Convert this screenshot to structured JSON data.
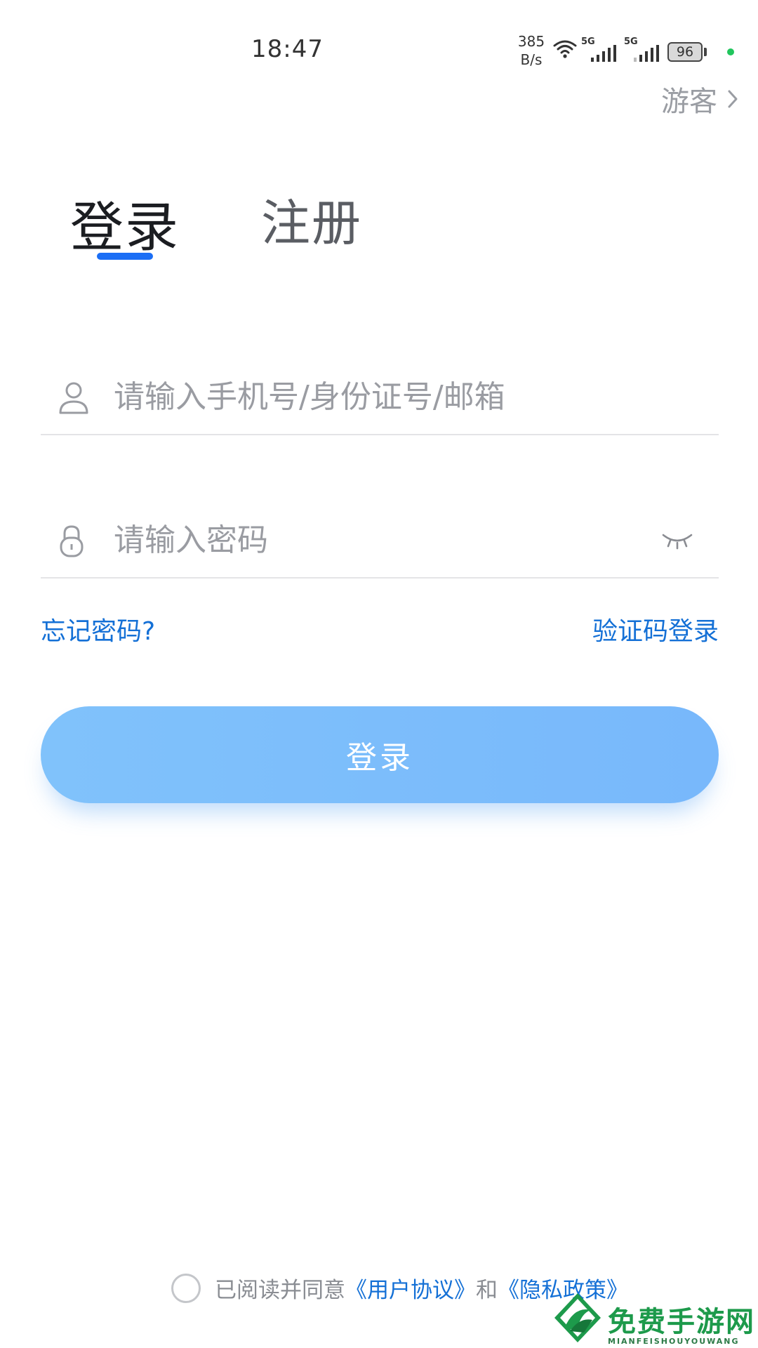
{
  "status_bar": {
    "time": "18:47",
    "net_speed_value": "385",
    "net_speed_unit": "B/s",
    "signal1_label": "5G",
    "signal2_label": "5G",
    "battery": "96",
    "wifi_icon": "wifi-icon",
    "signal_icon": "cellular-signal-icon"
  },
  "guest": {
    "label": "游客",
    "icon": "chevron-right-icon"
  },
  "tabs": [
    {
      "label": "登录",
      "active": true
    },
    {
      "label": "注册",
      "active": false
    }
  ],
  "form": {
    "account": {
      "placeholder": "请输入手机号/身份证号/邮箱",
      "value": "",
      "icon": "user-icon"
    },
    "password": {
      "placeholder": "请输入密码",
      "value": "",
      "icon": "lock-icon",
      "toggle_icon": "eye-closed-icon"
    }
  },
  "links": {
    "forgot_password": "忘记密码?",
    "sms_login": "验证码登录"
  },
  "login_button": {
    "label": "登录"
  },
  "agreement": {
    "prefix": "已阅读并同意",
    "user_agreement": "《用户协议》",
    "conjunction": "和",
    "privacy_policy": "《隐私政策》",
    "checked": false
  },
  "watermark": {
    "text": "免费手游网",
    "sub": "MIANFEISHOUYOUWANG"
  },
  "colors": {
    "accent": "#1b6ef5",
    "link": "#1470d6",
    "button": "#80c2fb",
    "watermark": "#1d9a4b"
  }
}
